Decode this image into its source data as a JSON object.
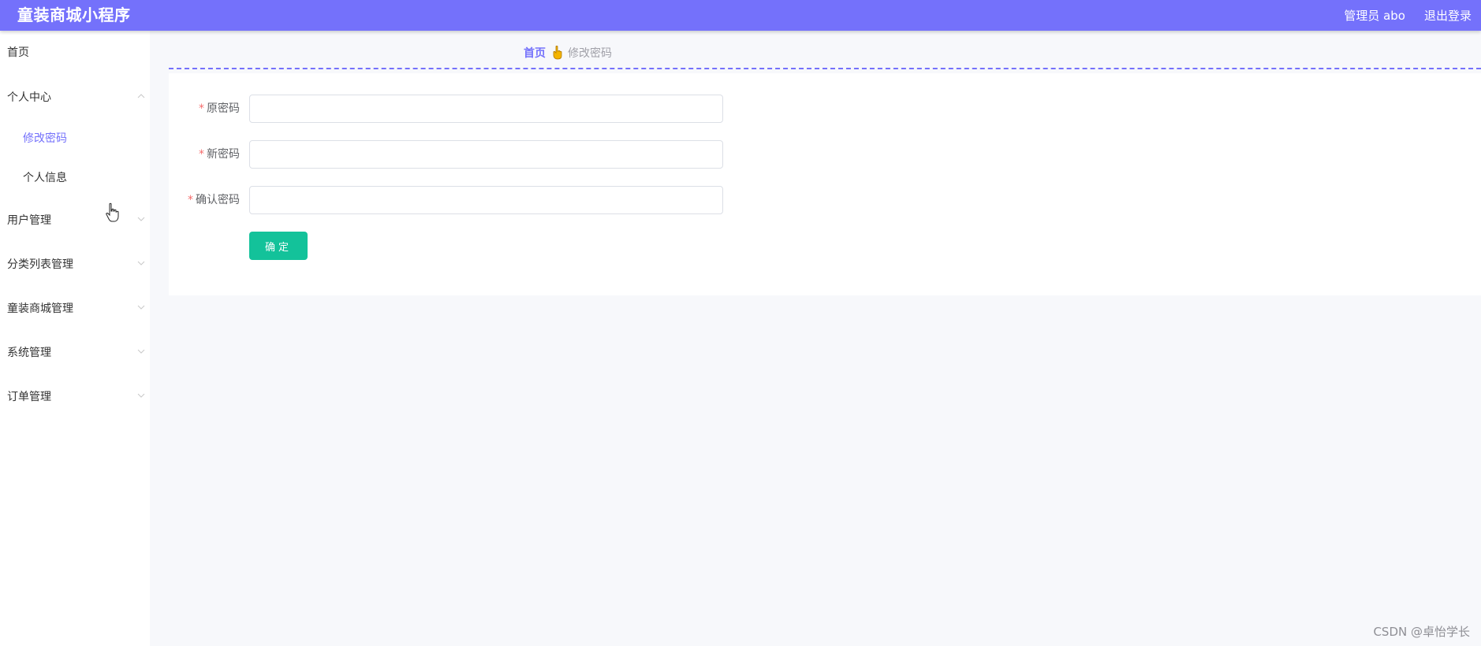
{
  "header": {
    "title": "童装商城小程序",
    "user": "管理员 abo",
    "logout": "退出登录",
    "bg_color": "#7471fb"
  },
  "sidebar": {
    "items": [
      {
        "label": "首页"
      },
      {
        "label": "个人中心",
        "expanded": true,
        "chevron": "chevron-up-icon"
      },
      {
        "label": "用户管理",
        "chevron": "chevron-down-icon"
      },
      {
        "label": "分类列表管理",
        "chevron": "chevron-down-icon"
      },
      {
        "label": "童装商城管理",
        "chevron": "chevron-down-icon"
      },
      {
        "label": "系统管理",
        "chevron": "chevron-down-icon"
      },
      {
        "label": "订单管理",
        "chevron": "chevron-down-icon"
      }
    ],
    "submenu": [
      {
        "label": "修改密码",
        "active": true
      },
      {
        "label": "个人信息"
      }
    ],
    "active_color": "#7471fb"
  },
  "breadcrumb": {
    "home": "首页",
    "separator_icon": "hand-icon",
    "current": "修改密码"
  },
  "form": {
    "fields": [
      {
        "label": "原密码",
        "required": true,
        "value": ""
      },
      {
        "label": "新密码",
        "required": true,
        "value": ""
      },
      {
        "label": "确认密码",
        "required": true,
        "value": ""
      }
    ],
    "required_mark": "*",
    "submit_label": "确定",
    "submit_color": "#13c29a"
  },
  "watermark": "CSDN @卓怡学长"
}
